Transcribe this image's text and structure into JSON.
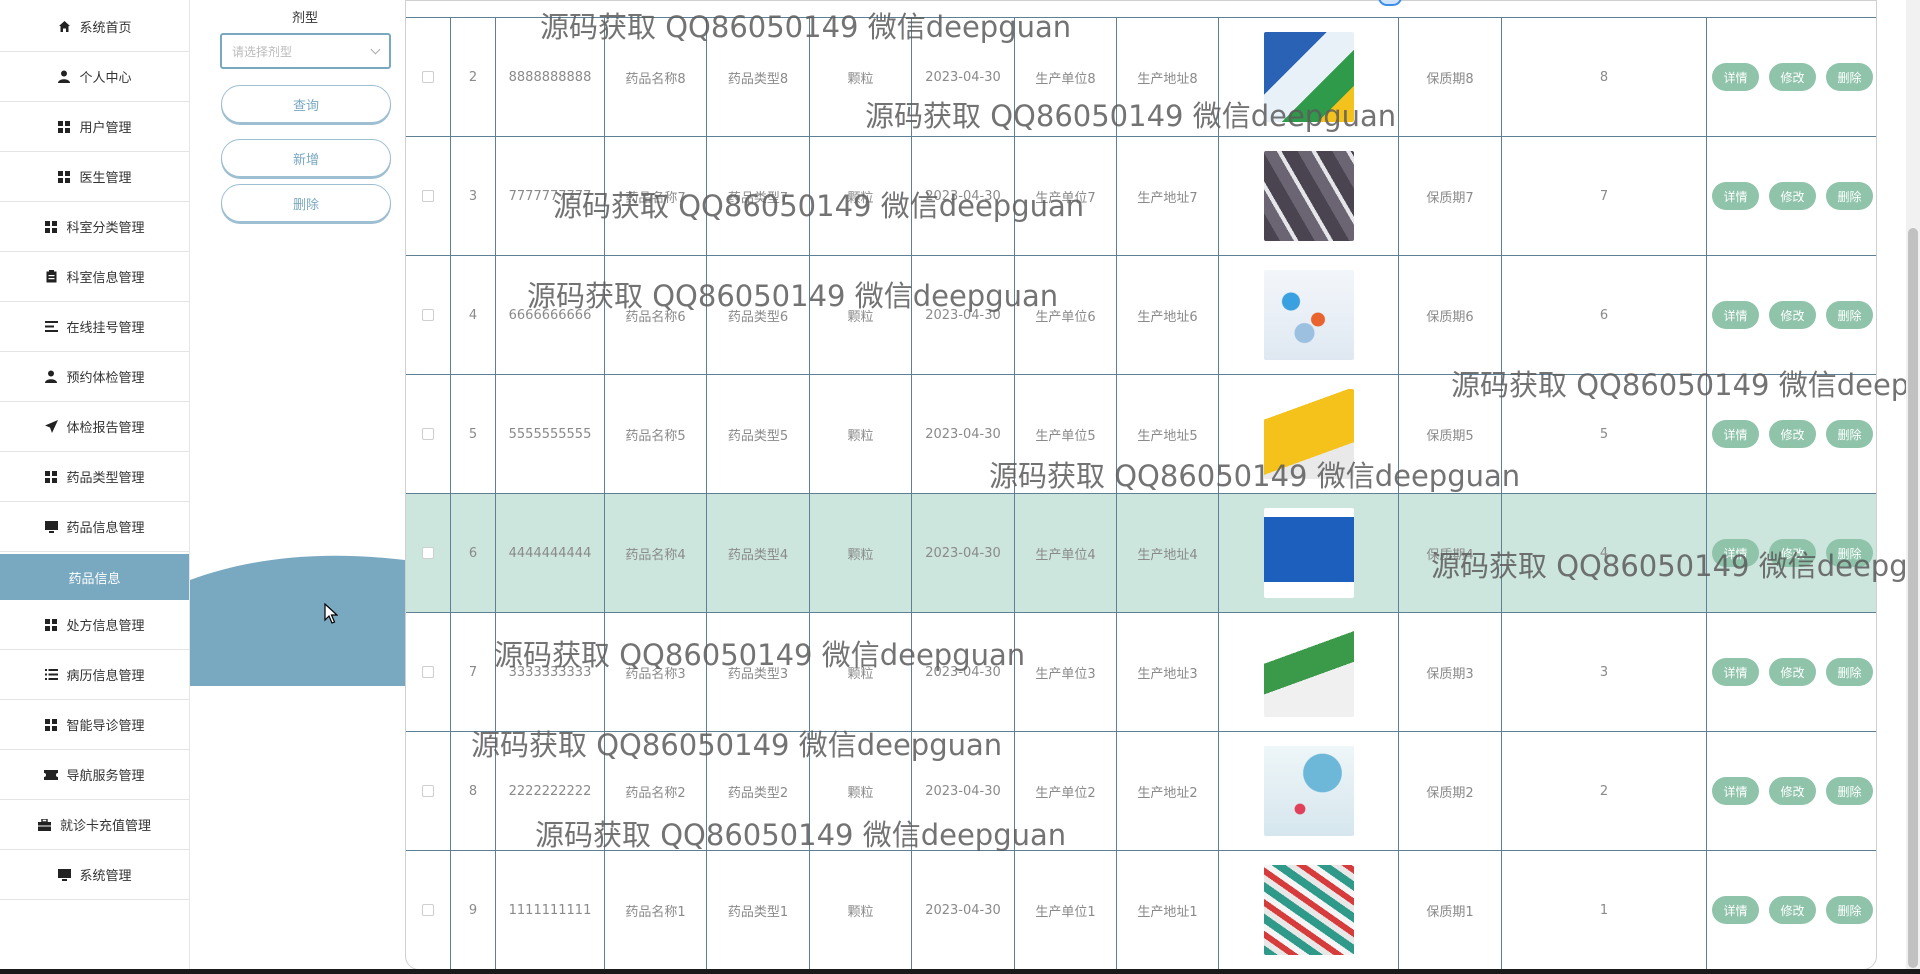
{
  "sidebar": {
    "items": [
      {
        "label": "系统首页",
        "icon": "home-icon"
      },
      {
        "label": "个人中心",
        "icon": "user-icon"
      },
      {
        "label": "用户管理",
        "icon": "grid-icon"
      },
      {
        "label": "医生管理",
        "icon": "grid-icon"
      },
      {
        "label": "科室分类管理",
        "icon": "grid-icon"
      },
      {
        "label": "科室信息管理",
        "icon": "clipboard-icon"
      },
      {
        "label": "在线挂号管理",
        "icon": "list-icon"
      },
      {
        "label": "预约体检管理",
        "icon": "user-icon"
      },
      {
        "label": "体检报告管理",
        "icon": "send-icon"
      },
      {
        "label": "药品类型管理",
        "icon": "grid-icon"
      },
      {
        "label": "药品信息管理",
        "icon": "monitor-icon"
      },
      {
        "label": "药品信息",
        "icon": ""
      },
      {
        "label": "处方信息管理",
        "icon": "grid-icon"
      },
      {
        "label": "病历信息管理",
        "icon": "list-icon"
      },
      {
        "label": "智能导诊管理",
        "icon": "grid-icon"
      },
      {
        "label": "导航服务管理",
        "icon": "ticket-icon"
      },
      {
        "label": "就诊卡充值管理",
        "icon": "briefcase-icon"
      },
      {
        "label": "系统管理",
        "icon": "monitor-icon"
      }
    ]
  },
  "search": {
    "label": "剂型",
    "placeholder": "请选择剂型",
    "query_label": "查询",
    "add_label": "新增",
    "delete_label": "删除"
  },
  "table": {
    "rows": [
      {
        "num": "2",
        "code": "8888888888",
        "name": "药品名称8",
        "type": "药品类型8",
        "form": "颗粒",
        "date": "2023-04-30",
        "maker": "生产单位8",
        "addr": "生产地址8",
        "shelf": "保质期8",
        "stock": "8"
      },
      {
        "num": "3",
        "code": "7777777777",
        "name": "药品名称7",
        "type": "药品类型7",
        "form": "颗粒",
        "date": "2023-04-30",
        "maker": "生产单位7",
        "addr": "生产地址7",
        "shelf": "保质期7",
        "stock": "7"
      },
      {
        "num": "4",
        "code": "6666666666",
        "name": "药品名称6",
        "type": "药品类型6",
        "form": "颗粒",
        "date": "2023-04-30",
        "maker": "生产单位6",
        "addr": "生产地址6",
        "shelf": "保质期6",
        "stock": "6"
      },
      {
        "num": "5",
        "code": "5555555555",
        "name": "药品名称5",
        "type": "药品类型5",
        "form": "颗粒",
        "date": "2023-04-30",
        "maker": "生产单位5",
        "addr": "生产地址5",
        "shelf": "保质期5",
        "stock": "5"
      },
      {
        "num": "6",
        "code": "4444444444",
        "name": "药品名称4",
        "type": "药品类型4",
        "form": "颗粒",
        "date": "2023-04-30",
        "maker": "生产单位4",
        "addr": "生产地址4",
        "shelf": "保质期4",
        "stock": "4"
      },
      {
        "num": "7",
        "code": "3333333333",
        "name": "药品名称3",
        "type": "药品类型3",
        "form": "颗粒",
        "date": "2023-04-30",
        "maker": "生产单位3",
        "addr": "生产地址3",
        "shelf": "保质期3",
        "stock": "3"
      },
      {
        "num": "8",
        "code": "2222222222",
        "name": "药品名称2",
        "type": "药品类型2",
        "form": "颗粒",
        "date": "2023-04-30",
        "maker": "生产单位2",
        "addr": "生产地址2",
        "shelf": "保质期2",
        "stock": "2"
      },
      {
        "num": "9",
        "code": "1111111111",
        "name": "药品名称1",
        "type": "药品类型1",
        "form": "颗粒",
        "date": "2023-04-30",
        "maker": "生产单位1",
        "addr": "生产地址1",
        "shelf": "保质期1",
        "stock": "1"
      }
    ],
    "actions": {
      "detail": "详情",
      "edit": "修改",
      "delete": "删除"
    }
  },
  "watermark": "源码获取 QQ86050149 微信deepguan",
  "colors": {
    "sidebar_active": "#79a8c1",
    "row_highlight": "#cce5dd",
    "action_button": "#8fc4ab"
  }
}
